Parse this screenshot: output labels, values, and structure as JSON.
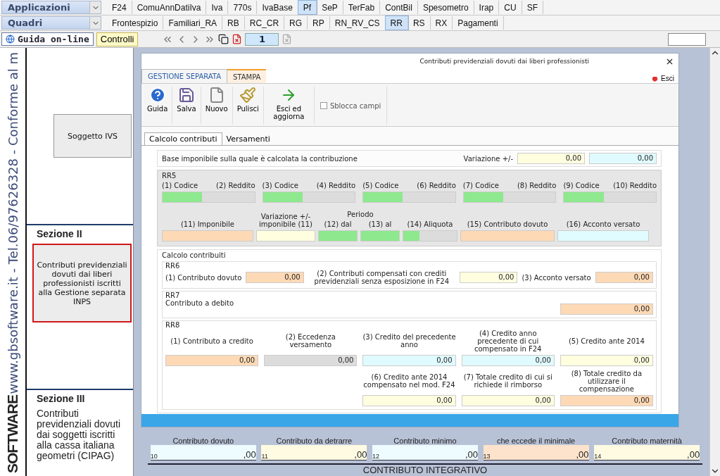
{
  "menus": [
    {
      "label": "Applicazioni",
      "tabs": [
        {
          "label": "F24",
          "selected": false
        },
        {
          "label": "ComuAnnDatiIva",
          "selected": false
        },
        {
          "label": "Iva",
          "selected": false
        },
        {
          "label": "770s",
          "selected": false
        },
        {
          "label": "IvaBase",
          "selected": false
        },
        {
          "label": "Pf",
          "selected": true
        },
        {
          "label": "SeP",
          "selected": false
        },
        {
          "label": "TerFab",
          "selected": false
        },
        {
          "label": "ContBil",
          "selected": false
        },
        {
          "label": "Spesometro",
          "selected": false
        },
        {
          "label": "Irap",
          "selected": false
        },
        {
          "label": "CU",
          "selected": false
        },
        {
          "label": "SF",
          "selected": false
        }
      ]
    },
    {
      "label": "Quadri",
      "tabs": [
        {
          "label": "Frontespizio",
          "selected": false
        },
        {
          "label": "Familiari_RA",
          "selected": false
        },
        {
          "label": "RB",
          "selected": false
        },
        {
          "label": "RC_CR",
          "selected": false
        },
        {
          "label": "RG",
          "selected": false
        },
        {
          "label": "RP",
          "selected": false
        },
        {
          "label": "RN_RV_CS",
          "selected": false
        },
        {
          "label": "RR",
          "selected": true
        },
        {
          "label": "RS",
          "selected": false
        },
        {
          "label": "RX",
          "selected": false
        },
        {
          "label": "Pagamenti",
          "selected": false
        }
      ]
    }
  ],
  "toolbar": {
    "help_button": "Guida on-line",
    "controls_button": "Controlli",
    "page": "1"
  },
  "sidebar": {
    "side_text": "www.gbsoftware.it - Tel.06/97626328 - Conforme al m",
    "logo": "SOFTWARE",
    "items": [
      {
        "kind": "button",
        "label": "Soggetto IVS",
        "selected": false
      },
      {
        "kind": "heading",
        "label": "Sezione II"
      },
      {
        "kind": "button",
        "label": "Contributi previdenziali dovuti dai liberi professionisti iscritti alla Gestione separata INPS",
        "selected": true
      },
      {
        "kind": "heading",
        "label": "Sezione III"
      },
      {
        "kind": "text",
        "label": "Contributi previdenziali dovuti dai soggetti iscritti alla cassa italiana geometri (CIPAG)"
      }
    ]
  },
  "form_strip": {
    "fields": [
      {
        "label": "Contributo dovuto",
        "number": "10",
        "value": ",00",
        "color": "#eefcff"
      },
      {
        "label": "Contributo da detrarre",
        "number": "11",
        "value": ",00",
        "color": "#fffbe2"
      },
      {
        "label": "Contributo minimo",
        "number": "12",
        "value": ",00",
        "color": "#eefcff"
      },
      {
        "label": "che eccede il minimale",
        "number": "13",
        "value": ",00",
        "color": "#fde3cc"
      },
      {
        "label": "Contributo maternità",
        "number": "14",
        "value": ",00",
        "color": "#fffbe2"
      }
    ],
    "section_title": "CONTRIBUTO INTEGRATIVO"
  },
  "dialog": {
    "title": "Contributi previdenziali dovuti dai liberi professionisti",
    "ribbon_tabs": [
      {
        "label": "GESTIONE SEPARATA",
        "selected": true
      },
      {
        "label": "STAMPA",
        "selected": false
      }
    ],
    "exit_label": "Esci",
    "tools": [
      {
        "kind": "help",
        "label": "Guida"
      },
      {
        "kind": "save",
        "label": "Salva"
      },
      {
        "kind": "new",
        "label": "Nuovo"
      },
      {
        "kind": "clean",
        "label": "Pulisci"
      },
      {
        "kind": "exit",
        "label": "Esci ed aggiorna"
      }
    ],
    "unlock": {
      "label": "Sblocca campi",
      "checked": false
    },
    "tabs": [
      {
        "label": "Calcolo contributi",
        "selected": true
      },
      {
        "label": "Versamenti",
        "selected": false
      }
    ],
    "base": {
      "label": "Base imponibile sulla quale è calcolata la contribuzione",
      "variation_label": "Variazione +/-",
      "fields": [
        {
          "value": "0,00",
          "color": "#ffffe0"
        },
        {
          "value": "0,00",
          "color": "#e0fbff"
        }
      ]
    },
    "rr5": {
      "title": "RR5",
      "pairs": [
        {
          "code_label": "(1) Codice",
          "income_label": "(2) Reddito"
        },
        {
          "code_label": "(3) Codice",
          "income_label": "(4) Reddito"
        },
        {
          "code_label": "(5) Codice",
          "income_label": "(6) Reddito"
        },
        {
          "code_label": "(7) Codice",
          "income_label": "(8) Reddito"
        },
        {
          "code_label": "(9) Codice",
          "income_label": "(10) Reddito"
        }
      ],
      "period_label": "Periodo",
      "row2": [
        {
          "label": "(11) Imponibile",
          "kind": "plain",
          "color": "#fdd9b5"
        },
        {
          "label": "Variazione +/- imponibile (11)",
          "kind": "plain",
          "color": "#ffffe0"
        },
        {
          "label": "(12) dal",
          "kind": "plain",
          "color": "#8ee88e"
        },
        {
          "label": "(13) al",
          "kind": "plain",
          "color": "#8ee88e"
        },
        {
          "label": "(14) Aliquota",
          "kind": "split",
          "color": "#8ee88e"
        },
        {
          "label": "(15) Contributo dovuto",
          "kind": "plain",
          "color": "#fdd9b5"
        },
        {
          "label": "(16) Acconto versato",
          "kind": "plain",
          "color": "#e0fbff"
        }
      ]
    },
    "calc": {
      "title": "Calcolo contribuiti",
      "rr6": {
        "title": "RR6",
        "fields": [
          {
            "label": "(1) Contributo dovuto",
            "value": "0,00",
            "color": "#fdd9b5"
          },
          {
            "label": "(2) Contributi compensati con crediti previdenziali senza esposizione in F24",
            "value": "0,00",
            "color": "#ffffe0"
          },
          {
            "label": "(3) Acconto versato",
            "value": "0,00",
            "color": "#fdd9b5"
          }
        ]
      },
      "rr7": {
        "title": "RR7",
        "label": "Contributo a debito",
        "value": "0,00",
        "color": "#fdd9b5"
      },
      "rr8": {
        "title": "RR8",
        "fields": [
          {
            "label": "(1) Contributo a credito",
            "value": "0,00",
            "color": "#fdd9b5"
          },
          {
            "label": "(2) Eccedenza versamento",
            "value": "0,00",
            "color": "#dcdcdc"
          },
          {
            "label": "(3) Credito del precedente anno",
            "value": "0,00",
            "color": "#e0fbff"
          },
          {
            "label": "(4) Credito anno precedente di cui compensato in F24",
            "value": "0,00",
            "color": "#e0fbff"
          },
          {
            "label": "(5) Credito ante 2014",
            "value": "0,00",
            "color": "#ffffe0"
          },
          {
            "label": "(6) Credito ante 2014 compensato nel mod. F24",
            "value": "0,00",
            "color": "#ffffe0"
          },
          {
            "label": "(7) Totale credito di cui si richiede il rimborso",
            "value": "0,00",
            "color": "#ffffe0"
          },
          {
            "label": "(8) Totale credito da utilizzare il compensazione",
            "value": "0,00",
            "color": "#fdd9b5"
          }
        ]
      }
    }
  }
}
